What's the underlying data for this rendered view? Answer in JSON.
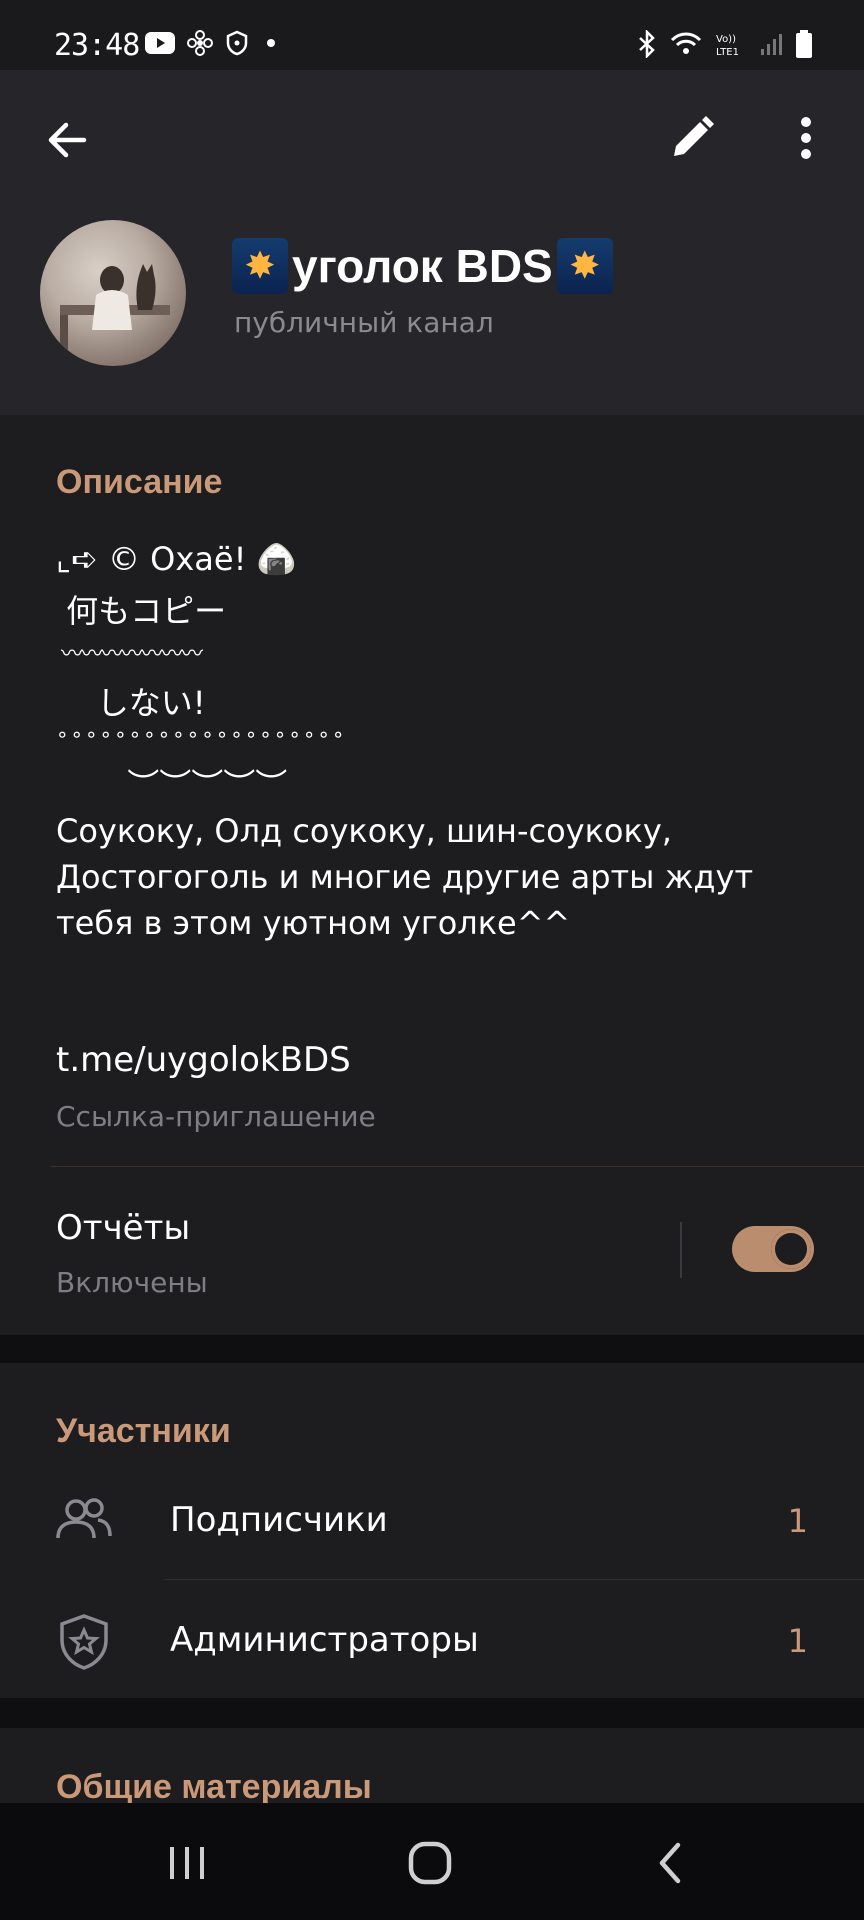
{
  "status_bar": {
    "time": "23:48"
  },
  "header": {
    "channel_name": "уголок BDS",
    "channel_type": "публичный канал"
  },
  "description": {
    "title": "Описание",
    "lines": [
      "⌞➪ © Охаё! 🍙",
      " 何もコピー",
      " 〰〰〰〰〰〰〰",
      "    しない!",
      "∘∘∘∘∘∘∘∘∘∘∘∘∘∘∘∘∘∘∘∘",
      "       ︶︶︶︶︶",
      "Соукоку, Олд соукоку, шин-соукоку,",
      "Достогоголь и многие другие арты ждут",
      "тебя в этом уютном уголке^^"
    ]
  },
  "invite": {
    "link": "t.me/uygolokBDS",
    "label": "Ссылка-приглашение"
  },
  "reports": {
    "label": "Отчёты",
    "status": "Включены",
    "enabled": true
  },
  "members": {
    "title": "Участники",
    "items": [
      {
        "label": "Подписчики",
        "count": "1",
        "icon": "people-icon"
      },
      {
        "label": "Администраторы",
        "count": "1",
        "icon": "shield-star-icon"
      }
    ]
  },
  "shared": {
    "title": "Общие материалы"
  },
  "colors": {
    "accent": "#c9997a",
    "toggle": "#b98d6d",
    "background": "#1d1c1f",
    "header": "#262529"
  }
}
